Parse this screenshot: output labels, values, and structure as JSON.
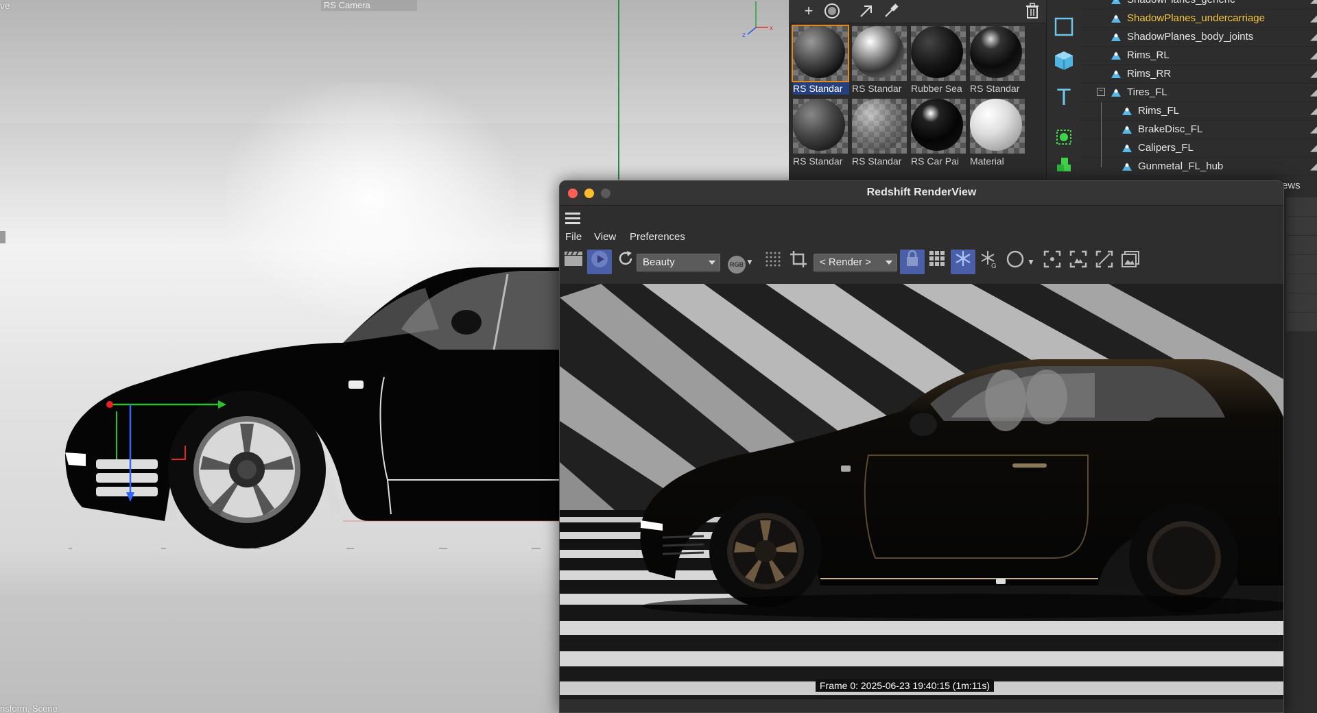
{
  "viewport": {
    "mode_label": "ve",
    "camera_label": "RS Camera",
    "footer_label": "nsform, Scene"
  },
  "material_browser": {
    "toolbar": [
      "add-icon",
      "material-sphere-icon",
      "arrow-icon",
      "eyedropper-icon",
      "trash-icon"
    ],
    "materials": [
      {
        "label": "RS Standar",
        "selected": true
      },
      {
        "label": "RS Standar",
        "selected": false
      },
      {
        "label": "Rubber Sea",
        "selected": false
      },
      {
        "label": "RS Standar",
        "selected": false
      },
      {
        "label": "RS Standar",
        "selected": false
      },
      {
        "label": "RS Standar",
        "selected": false
      },
      {
        "label": "RS Car Pai",
        "selected": false
      },
      {
        "label": "Material",
        "selected": false
      }
    ]
  },
  "object_manager": {
    "rows": [
      {
        "label": "ShadowPlanes_generic",
        "indent": 0,
        "highlight": false
      },
      {
        "label": "ShadowPlanes_undercarriage",
        "indent": 0,
        "highlight": true
      },
      {
        "label": "ShadowPlanes_body_joints",
        "indent": 0,
        "highlight": false
      },
      {
        "label": "Rims_RL",
        "indent": 0,
        "highlight": false
      },
      {
        "label": "Rims_RR",
        "indent": 0,
        "highlight": false
      },
      {
        "label": "Tires_FL",
        "indent": 0,
        "highlight": false,
        "expanded": true
      },
      {
        "label": "Rims_FL",
        "indent": 1,
        "highlight": false
      },
      {
        "label": "BrakeDisc_FL",
        "indent": 1,
        "highlight": false
      },
      {
        "label": "Calipers_FL",
        "indent": 1,
        "highlight": false
      },
      {
        "label": "Gunmetal_FL_hub",
        "indent": 1,
        "highlight": false
      }
    ],
    "partial_label": "ews"
  },
  "renderview": {
    "title": "Redshift RenderView",
    "menu": [
      "File",
      "View",
      "Preferences"
    ],
    "aov_dropdown": "Beauty",
    "channel_button": "RGB",
    "render_dropdown": "< Render >",
    "status": "Frame  0:  2025-06-23  19:40:15  (1m:11s)"
  },
  "colors": {
    "accent_blue": "#4a5fa8",
    "highlight_yellow": "#f5c542",
    "selection_orange": "#e08a1e",
    "traffic_red": "#ff5f57",
    "traffic_yellow": "#febc2e",
    "traffic_gray": "#5a5a5a"
  }
}
